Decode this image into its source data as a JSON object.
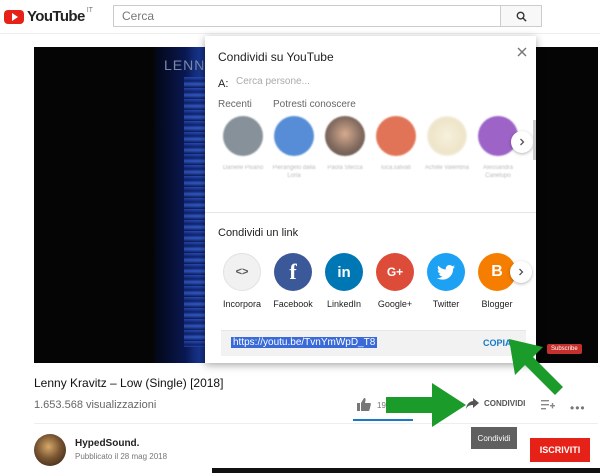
{
  "header": {
    "logo_text": "YouTube",
    "logo_country": "IT",
    "search_placeholder": "Cerca"
  },
  "video": {
    "overlay_text": "LENN",
    "subscribe_badge": "Subscribe"
  },
  "share_dialog": {
    "title": "Condividi su YouTube",
    "to_label": "A:",
    "to_placeholder": "Cerca persone...",
    "recent_label": "Recenti",
    "suggested_label": "Potresti conoscere",
    "contacts": [
      {
        "name": "Daniele Pisano",
        "color": "#5f6d78"
      },
      {
        "name": "Pierangelo dalla Loria",
        "color": "#1e68c9"
      },
      {
        "name": "Paola Stecca",
        "color": "#5a3a2a"
      },
      {
        "name": "luca.salvati",
        "color": "#d7461f"
      },
      {
        "name": "Achille Valentina",
        "color": "#e8dcb8"
      },
      {
        "name": "Alessandra Canelupo",
        "color": "#7d2fb5"
      }
    ],
    "link_section_title": "Condividi un link",
    "share_targets": [
      {
        "label": "Incorpora",
        "glyph": "<>",
        "color": "#f1f1f1",
        "icon": "embed-icon"
      },
      {
        "label": "Facebook",
        "glyph": "f",
        "color": "#3b5998",
        "icon": "facebook-icon"
      },
      {
        "label": "LinkedIn",
        "glyph": "in",
        "color": "#0077b5",
        "icon": "linkedin-icon"
      },
      {
        "label": "Google+",
        "glyph": "G+",
        "color": "#dd4b39",
        "icon": "google-plus-icon"
      },
      {
        "label": "Twitter",
        "glyph": "t",
        "color": "#1da1f2",
        "icon": "twitter-icon"
      },
      {
        "label": "Blogger",
        "glyph": "B",
        "color": "#f57d00",
        "icon": "blogger-icon"
      }
    ],
    "link_url": "https://youtu.be/TvnYmWpD_T8",
    "copy_label": "COPIA"
  },
  "video_info": {
    "title": "Lenny Kravitz – Low (Single) [2018]",
    "views": "1.653.568 visualizzazioni",
    "like_count": "19",
    "share_label": "CONDIVIDI",
    "more": "•••",
    "tooltip": "Condividi"
  },
  "channel": {
    "name": "HypedSound.",
    "published": "Pubblicato il 28 mag 2018",
    "subscribe_label": "ISCRIVITI"
  },
  "colors": {
    "brand_red": "#e62117",
    "link_blue": "#167ac6",
    "arrow_green": "#1a9b2a"
  }
}
